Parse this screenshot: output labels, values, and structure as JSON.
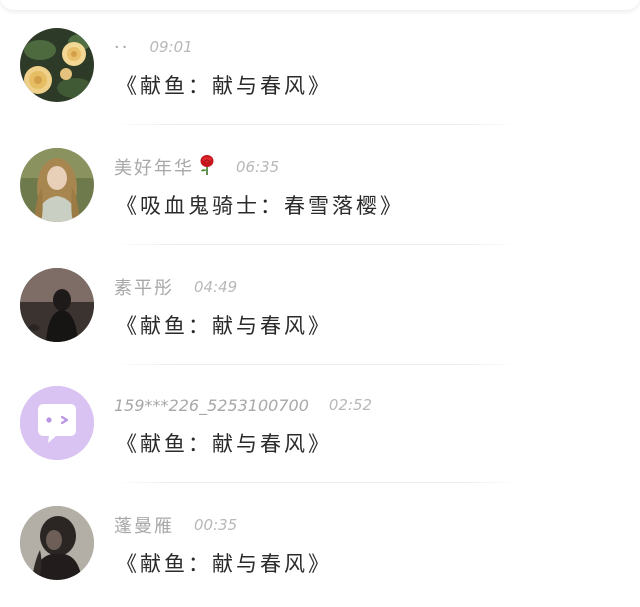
{
  "comments": [
    {
      "username": "··",
      "time": "09:01",
      "message": "《献鱼：献与春风》",
      "avatar_icon": "yellow-roses-avatar-icon"
    },
    {
      "username": "美好年华",
      "time": "06:35",
      "message": "《吸血鬼骑士：春雪落樱》",
      "avatar_icon": "girl-long-hair-avatar-icon",
      "emoji": "rose"
    },
    {
      "username": "素平彤",
      "time": "04:49",
      "message": "《献鱼：献与春风》",
      "avatar_icon": "dark-silhouette-avatar-icon"
    },
    {
      "username": "159***226_5253100700",
      "time": "02:52",
      "message": "《献鱼：献与春风》",
      "avatar_icon": "chat-bubble-default-avatar-icon"
    },
    {
      "username": "蓬曼雁",
      "time": "00:35",
      "message": "《献鱼：献与春风》",
      "avatar_icon": "girl-in-dark-avatar-icon"
    }
  ],
  "colors": {
    "username": "#a8a8a8",
    "time": "#b8b8b8",
    "message": "#2a2a2a",
    "default_avatar_bg": "#d9c3f2"
  }
}
